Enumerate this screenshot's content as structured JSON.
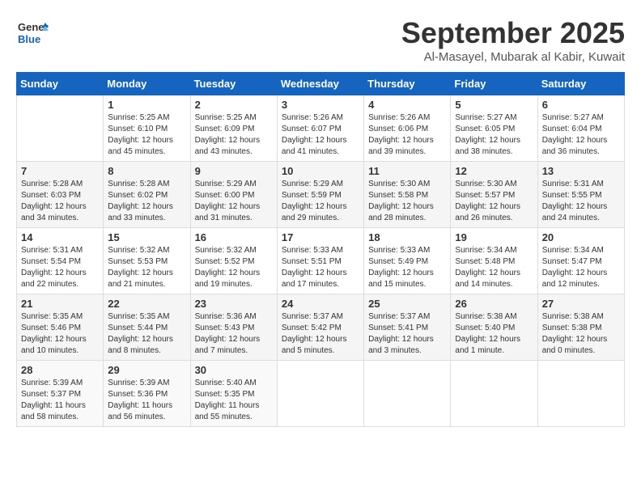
{
  "logo": {
    "line1": "General",
    "line2": "Blue"
  },
  "header": {
    "month": "September 2025",
    "location": "Al-Masayel, Mubarak al Kabir, Kuwait"
  },
  "weekdays": [
    "Sunday",
    "Monday",
    "Tuesday",
    "Wednesday",
    "Thursday",
    "Friday",
    "Saturday"
  ],
  "weeks": [
    [
      {
        "day": "",
        "info": ""
      },
      {
        "day": "1",
        "info": "Sunrise: 5:25 AM\nSunset: 6:10 PM\nDaylight: 12 hours\nand 45 minutes."
      },
      {
        "day": "2",
        "info": "Sunrise: 5:25 AM\nSunset: 6:09 PM\nDaylight: 12 hours\nand 43 minutes."
      },
      {
        "day": "3",
        "info": "Sunrise: 5:26 AM\nSunset: 6:07 PM\nDaylight: 12 hours\nand 41 minutes."
      },
      {
        "day": "4",
        "info": "Sunrise: 5:26 AM\nSunset: 6:06 PM\nDaylight: 12 hours\nand 39 minutes."
      },
      {
        "day": "5",
        "info": "Sunrise: 5:27 AM\nSunset: 6:05 PM\nDaylight: 12 hours\nand 38 minutes."
      },
      {
        "day": "6",
        "info": "Sunrise: 5:27 AM\nSunset: 6:04 PM\nDaylight: 12 hours\nand 36 minutes."
      }
    ],
    [
      {
        "day": "7",
        "info": "Sunrise: 5:28 AM\nSunset: 6:03 PM\nDaylight: 12 hours\nand 34 minutes."
      },
      {
        "day": "8",
        "info": "Sunrise: 5:28 AM\nSunset: 6:02 PM\nDaylight: 12 hours\nand 33 minutes."
      },
      {
        "day": "9",
        "info": "Sunrise: 5:29 AM\nSunset: 6:00 PM\nDaylight: 12 hours\nand 31 minutes."
      },
      {
        "day": "10",
        "info": "Sunrise: 5:29 AM\nSunset: 5:59 PM\nDaylight: 12 hours\nand 29 minutes."
      },
      {
        "day": "11",
        "info": "Sunrise: 5:30 AM\nSunset: 5:58 PM\nDaylight: 12 hours\nand 28 minutes."
      },
      {
        "day": "12",
        "info": "Sunrise: 5:30 AM\nSunset: 5:57 PM\nDaylight: 12 hours\nand 26 minutes."
      },
      {
        "day": "13",
        "info": "Sunrise: 5:31 AM\nSunset: 5:55 PM\nDaylight: 12 hours\nand 24 minutes."
      }
    ],
    [
      {
        "day": "14",
        "info": "Sunrise: 5:31 AM\nSunset: 5:54 PM\nDaylight: 12 hours\nand 22 minutes."
      },
      {
        "day": "15",
        "info": "Sunrise: 5:32 AM\nSunset: 5:53 PM\nDaylight: 12 hours\nand 21 minutes."
      },
      {
        "day": "16",
        "info": "Sunrise: 5:32 AM\nSunset: 5:52 PM\nDaylight: 12 hours\nand 19 minutes."
      },
      {
        "day": "17",
        "info": "Sunrise: 5:33 AM\nSunset: 5:51 PM\nDaylight: 12 hours\nand 17 minutes."
      },
      {
        "day": "18",
        "info": "Sunrise: 5:33 AM\nSunset: 5:49 PM\nDaylight: 12 hours\nand 15 minutes."
      },
      {
        "day": "19",
        "info": "Sunrise: 5:34 AM\nSunset: 5:48 PM\nDaylight: 12 hours\nand 14 minutes."
      },
      {
        "day": "20",
        "info": "Sunrise: 5:34 AM\nSunset: 5:47 PM\nDaylight: 12 hours\nand 12 minutes."
      }
    ],
    [
      {
        "day": "21",
        "info": "Sunrise: 5:35 AM\nSunset: 5:46 PM\nDaylight: 12 hours\nand 10 minutes."
      },
      {
        "day": "22",
        "info": "Sunrise: 5:35 AM\nSunset: 5:44 PM\nDaylight: 12 hours\nand 8 minutes."
      },
      {
        "day": "23",
        "info": "Sunrise: 5:36 AM\nSunset: 5:43 PM\nDaylight: 12 hours\nand 7 minutes."
      },
      {
        "day": "24",
        "info": "Sunrise: 5:37 AM\nSunset: 5:42 PM\nDaylight: 12 hours\nand 5 minutes."
      },
      {
        "day": "25",
        "info": "Sunrise: 5:37 AM\nSunset: 5:41 PM\nDaylight: 12 hours\nand 3 minutes."
      },
      {
        "day": "26",
        "info": "Sunrise: 5:38 AM\nSunset: 5:40 PM\nDaylight: 12 hours\nand 1 minute."
      },
      {
        "day": "27",
        "info": "Sunrise: 5:38 AM\nSunset: 5:38 PM\nDaylight: 12 hours\nand 0 minutes."
      }
    ],
    [
      {
        "day": "28",
        "info": "Sunrise: 5:39 AM\nSunset: 5:37 PM\nDaylight: 11 hours\nand 58 minutes."
      },
      {
        "day": "29",
        "info": "Sunrise: 5:39 AM\nSunset: 5:36 PM\nDaylight: 11 hours\nand 56 minutes."
      },
      {
        "day": "30",
        "info": "Sunrise: 5:40 AM\nSunset: 5:35 PM\nDaylight: 11 hours\nand 55 minutes."
      },
      {
        "day": "",
        "info": ""
      },
      {
        "day": "",
        "info": ""
      },
      {
        "day": "",
        "info": ""
      },
      {
        "day": "",
        "info": ""
      }
    ]
  ]
}
